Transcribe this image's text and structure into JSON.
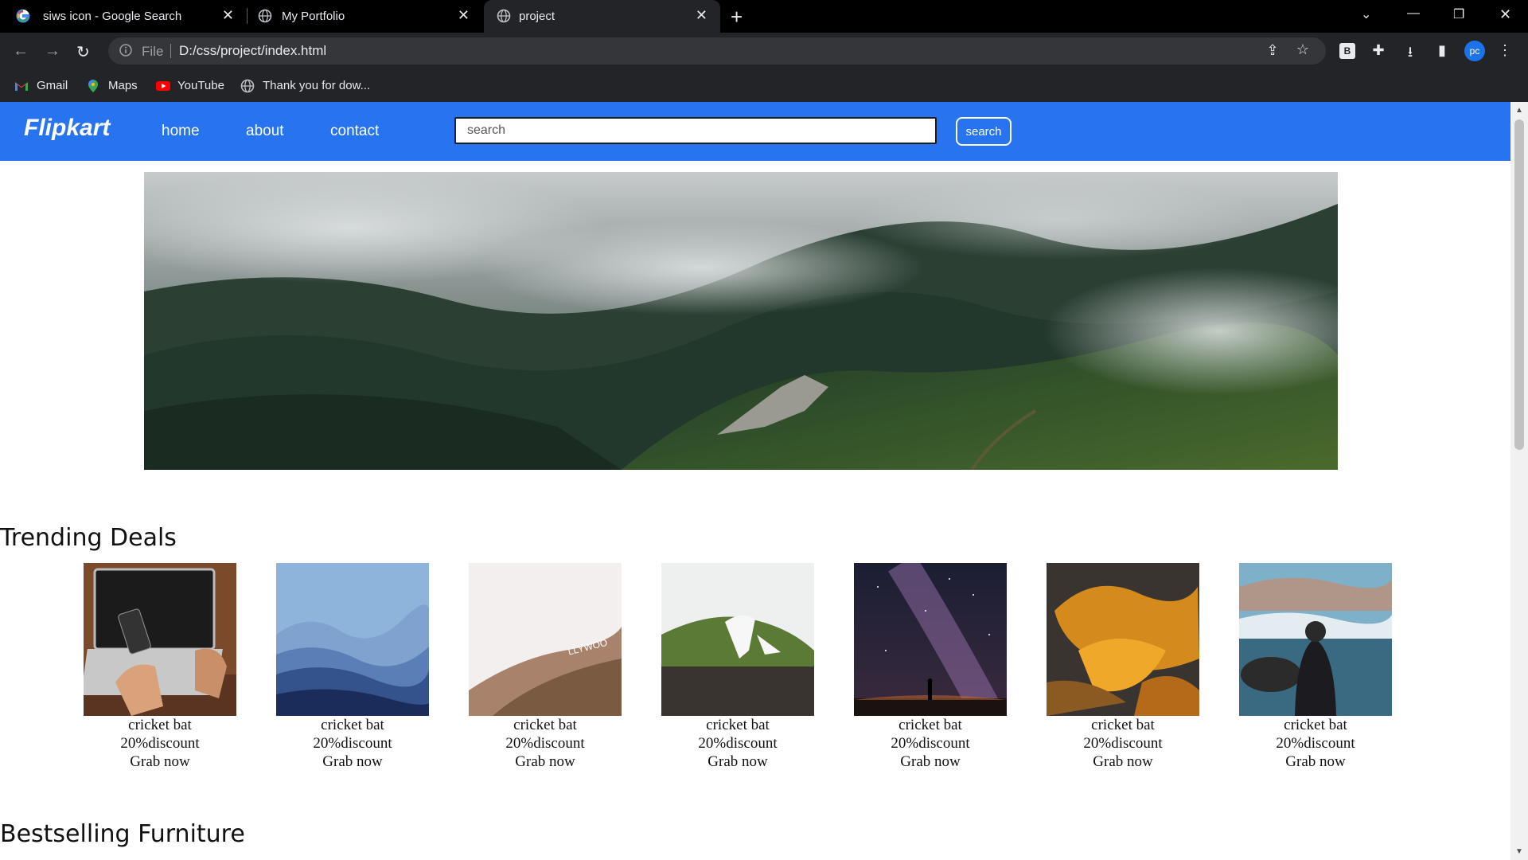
{
  "browser": {
    "tabs": [
      {
        "title": "siws icon - Google Search",
        "active": false,
        "icon": "google-icon"
      },
      {
        "title": "My Portfolio",
        "active": false,
        "icon": "globe-icon"
      },
      {
        "title": "project",
        "active": true,
        "icon": "globe-icon"
      }
    ],
    "address": {
      "scheme": "File",
      "url": "D:/css/project/index.html"
    },
    "profile_initials": "pc",
    "extension_letter": "B",
    "bookmarks": [
      {
        "label": "Gmail",
        "icon": "gmail-icon"
      },
      {
        "label": "Maps",
        "icon": "maps-icon"
      },
      {
        "label": "YouTube",
        "icon": "youtube-icon"
      },
      {
        "label": "Thank you for dow...",
        "icon": "globe-icon"
      }
    ]
  },
  "site": {
    "logo": "Flipkart",
    "nav": [
      "home",
      "about",
      "contact"
    ],
    "search_placeholder": "search",
    "search_button": "search",
    "sections": {
      "trending": "Trending Deals",
      "furniture": "Bestselling Furniture"
    },
    "deals": [
      {
        "name": "cricket bat",
        "discount": "20%discount",
        "cta": "Grab now",
        "image": "laptop-phone"
      },
      {
        "name": "cricket bat",
        "discount": "20%discount",
        "cta": "Grab now",
        "image": "blue-mountains"
      },
      {
        "name": "cricket bat",
        "discount": "20%discount",
        "cta": "Grab now",
        "image": "hollywood-hill"
      },
      {
        "name": "cricket bat",
        "discount": "20%discount",
        "cta": "Grab now",
        "image": "snowy-hill"
      },
      {
        "name": "cricket bat",
        "discount": "20%discount",
        "cta": "Grab now",
        "image": "milky-way"
      },
      {
        "name": "cricket bat",
        "discount": "20%discount",
        "cta": "Grab now",
        "image": "autumn-leaves"
      },
      {
        "name": "cricket bat",
        "discount": "20%discount",
        "cta": "Grab now",
        "image": "lake-person"
      }
    ]
  },
  "colors": {
    "navbar": "#2874f0",
    "chrome_dark": "#232427",
    "tabbar": "#000000"
  }
}
